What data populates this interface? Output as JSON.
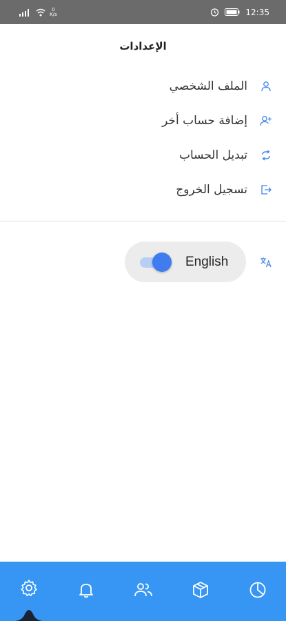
{
  "status_bar": {
    "speed_value": "0",
    "speed_unit": "K/s",
    "time": "12:35"
  },
  "header": {
    "title": "الإعدادات"
  },
  "menu": {
    "items": [
      {
        "label": "الملف الشخصي",
        "icon": "user-icon"
      },
      {
        "label": "إضافة حساب أخر",
        "icon": "add-user-icon"
      },
      {
        "label": "تبديل الحساب",
        "icon": "switch-icon"
      },
      {
        "label": "تسجيل الخروج",
        "icon": "logout-icon"
      }
    ]
  },
  "language": {
    "label": "English",
    "toggle_on": true,
    "icon": "translate-icon"
  },
  "bottom_nav": {
    "items": [
      "settings-icon",
      "bell-icon",
      "users-icon",
      "box-icon",
      "pie-chart-icon"
    ],
    "active_index": 0
  },
  "colors": {
    "accent": "#3796f4",
    "icon_blue": "#3f86e8",
    "toggle_thumb": "#3f7cf0",
    "toggle_track": "#b7cef5",
    "status_bar": "#6b6b6b"
  }
}
